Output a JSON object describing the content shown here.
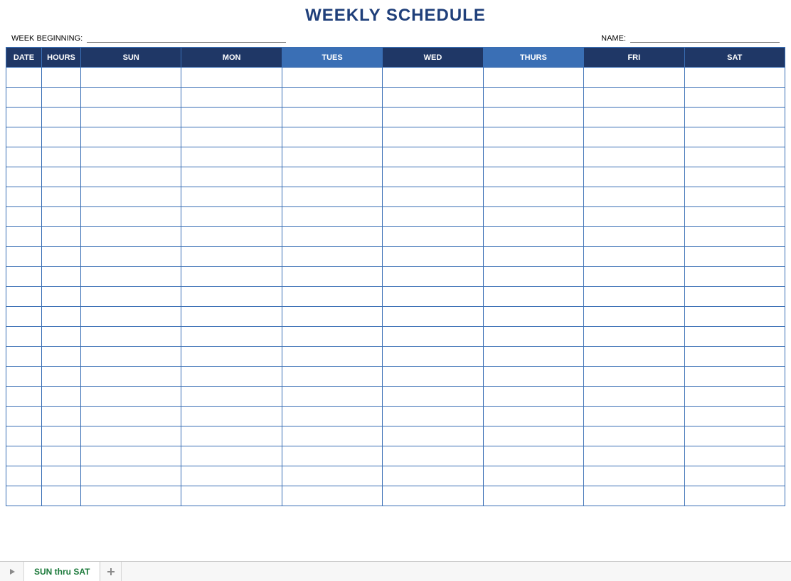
{
  "title": "WEEKLY SCHEDULE",
  "meta": {
    "week_label": "WEEK BEGINNING:",
    "week_value": "",
    "name_label": "NAME:",
    "name_value": ""
  },
  "columns": {
    "date": "DATE",
    "hours": "HOURS",
    "days": [
      "SUN",
      "MON",
      "TUES",
      "WED",
      "THURS",
      "FRI",
      "SAT"
    ]
  },
  "row_count": 22,
  "sheet_tab": "SUN thru SAT"
}
